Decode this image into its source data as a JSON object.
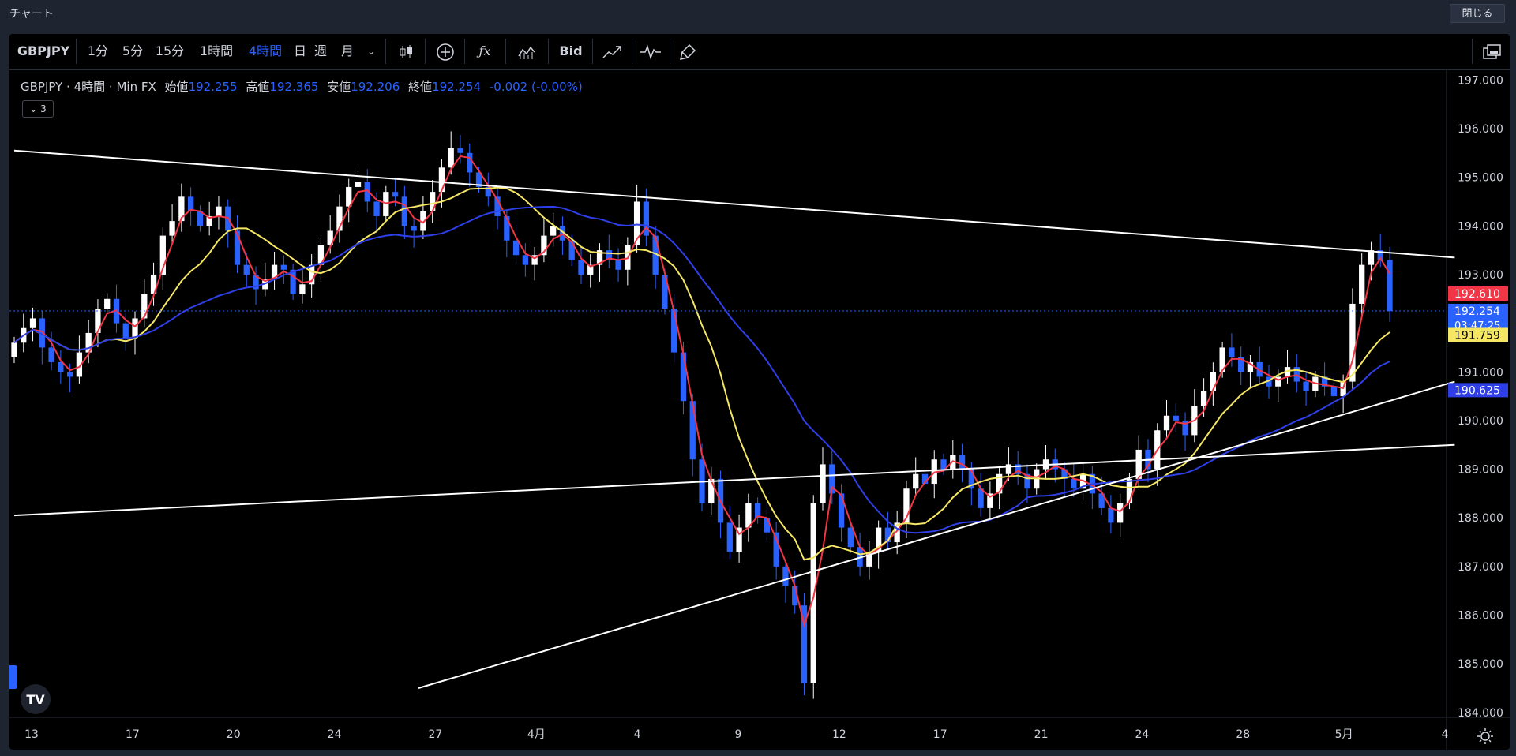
{
  "window": {
    "title": "チャート",
    "close_label": "閉じる"
  },
  "toolbar": {
    "symbol": "GBPJPY",
    "intervals": [
      "1分",
      "5分",
      "15分",
      "1時間",
      "4時間",
      "日",
      "週",
      "月"
    ],
    "active_interval": "4時間",
    "bid_label": "Bid"
  },
  "legend": {
    "symbol": "GBPJPY",
    "interval": "4時間",
    "source": "Min FX",
    "open_label": "始値",
    "open": "192.255",
    "high_label": "高値",
    "high": "192.365",
    "low_label": "安値",
    "low": "192.206",
    "close_label": "終値",
    "close": "192.254",
    "change": "-0.002 (-0.00%)",
    "collapse_count": "3"
  },
  "colors": {
    "up": "#ffffff",
    "down": "#2962ff",
    "ma_short": "#f23645",
    "ma_mid": "#f5e663",
    "ma_long": "#2f3fe8",
    "trend": "#ffffff",
    "grid": "#000000"
  },
  "chart_data": {
    "type": "candlestick",
    "ylim": [
      183.9,
      197.2
    ],
    "y_ticks": [
      "197.000",
      "196.000",
      "195.000",
      "194.000",
      "193.000",
      "191.000",
      "190.000",
      "189.000",
      "188.000",
      "187.000",
      "186.000",
      "185.000",
      "184.000"
    ],
    "x_ticks": [
      "13",
      "17",
      "20",
      "24",
      "27",
      "4月",
      "4",
      "9",
      "12",
      "17",
      "21",
      "24",
      "28",
      "5月",
      "4"
    ],
    "price_labels": [
      {
        "value": 192.61,
        "text": "192.610",
        "color": "#f23645"
      },
      {
        "value": 192.254,
        "text": "192.254",
        "color": "#2962ff",
        "countdown": "03:47:25"
      },
      {
        "value": 191.759,
        "text": "191.759",
        "color": "#f5e663"
      },
      {
        "value": 190.625,
        "text": "190.625",
        "color": "#2f3fe8"
      }
    ],
    "closes": [
      191.6,
      191.9,
      192.1,
      191.5,
      191.2,
      191.0,
      190.9,
      191.4,
      191.8,
      192.3,
      192.5,
      192.0,
      191.7,
      192.1,
      192.6,
      193.0,
      193.8,
      194.1,
      194.6,
      194.3,
      194.0,
      194.2,
      194.4,
      193.9,
      193.2,
      193.0,
      192.7,
      192.9,
      193.2,
      193.1,
      192.6,
      192.8,
      193.2,
      193.6,
      193.9,
      194.4,
      194.8,
      194.9,
      194.5,
      194.2,
      194.7,
      194.6,
      194.0,
      193.9,
      194.3,
      194.7,
      195.2,
      195.6,
      195.5,
      195.1,
      194.8,
      194.6,
      194.2,
      193.7,
      193.4,
      193.2,
      193.4,
      193.8,
      194.0,
      193.7,
      193.3,
      193.0,
      193.2,
      193.5,
      193.3,
      193.1,
      193.6,
      194.5,
      193.8,
      193.0,
      192.3,
      191.4,
      190.4,
      189.2,
      188.3,
      188.8,
      187.9,
      187.3,
      187.8,
      188.3,
      188.0,
      187.7,
      187.0,
      186.6,
      186.2,
      184.6,
      188.3,
      189.1,
      188.5,
      187.8,
      187.4,
      187.0,
      187.3,
      187.8,
      187.5,
      187.9,
      188.6,
      188.9,
      188.7,
      189.2,
      189.0,
      189.3,
      189.0,
      188.6,
      188.2,
      188.5,
      188.9,
      189.1,
      188.9,
      188.6,
      189.0,
      189.2,
      189.0,
      188.8,
      188.6,
      188.9,
      188.5,
      188.2,
      187.9,
      188.3,
      188.8,
      189.4,
      189.0,
      189.8,
      190.1,
      190.0,
      189.7,
      190.3,
      190.6,
      191.0,
      191.5,
      191.3,
      191.0,
      191.2,
      190.9,
      190.7,
      190.9,
      191.1,
      190.8,
      190.6,
      190.9,
      190.7,
      190.5,
      190.8,
      192.4,
      193.2,
      193.5,
      193.3,
      192.25
    ]
  }
}
